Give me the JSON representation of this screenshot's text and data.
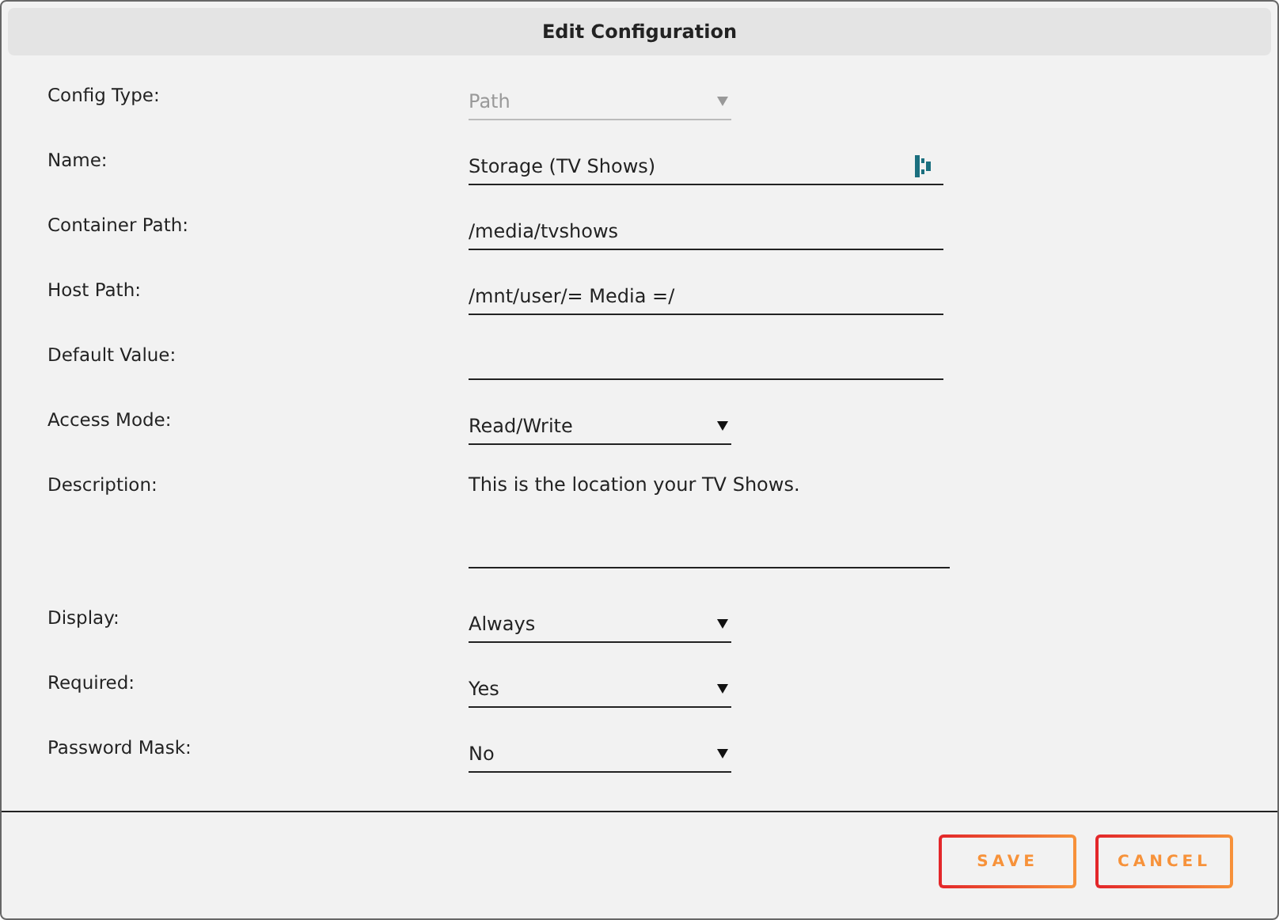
{
  "window": {
    "title": "Edit Configuration"
  },
  "fields": [
    {
      "label": "Config Type:",
      "kind": "select",
      "value": "Path",
      "disabled": true
    },
    {
      "label": "Name:",
      "kind": "text",
      "value": "Storage (TV Shows)",
      "icon_button": true
    },
    {
      "label": "Container Path:",
      "kind": "text",
      "value": "/media/tvshows"
    },
    {
      "label": "Host Path:",
      "kind": "text",
      "value": "/mnt/user/= Media =/"
    },
    {
      "label": "Default Value:",
      "kind": "text"
    },
    {
      "label": "Access Mode:",
      "kind": "select",
      "value": "Read/Write",
      "disabled": false
    },
    {
      "label": "Description:",
      "kind": "textarea",
      "value": "This is the location your TV Shows."
    },
    {
      "label": "Display:",
      "kind": "select",
      "value": "Always",
      "disabled": false
    },
    {
      "label": "Required:",
      "kind": "select",
      "value": "Yes",
      "disabled": false
    },
    {
      "label": "Password Mask:",
      "kind": "select",
      "value": "No",
      "disabled": false
    }
  ],
  "buttons": [
    "SAVE",
    "CANCEL"
  ]
}
